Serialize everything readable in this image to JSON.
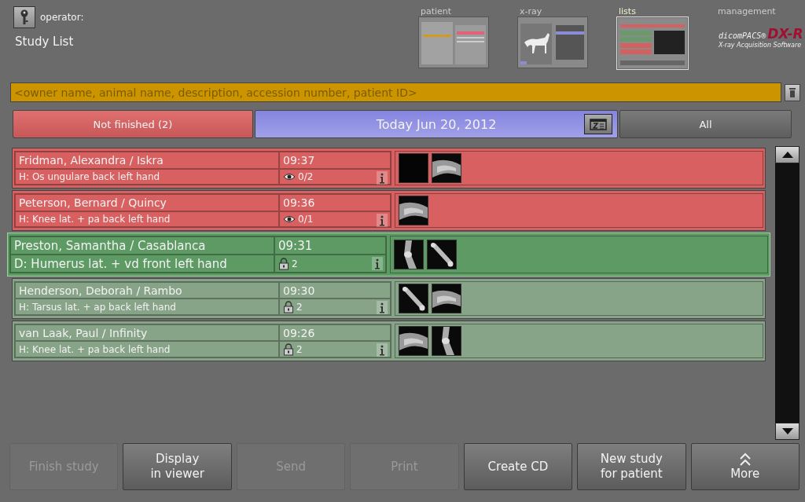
{
  "header": {
    "operator_label": "operator:",
    "title": "Study List"
  },
  "nav": [
    {
      "label": "patient",
      "kind": "patient",
      "selected": false
    },
    {
      "label": "x-ray",
      "kind": "xray",
      "selected": false
    },
    {
      "label": "lists",
      "kind": "lists",
      "selected": true
    },
    {
      "label": "management",
      "kind": "logo",
      "selected": false
    }
  ],
  "logo": {
    "brand": "dicomPACS®",
    "product": "DX-R",
    "tagline": "X-ray Acquisition Software"
  },
  "search": {
    "placeholder": "<owner name, animal name, description, accession number, patient ID>"
  },
  "filters": [
    {
      "label": "Not finished (2)",
      "kind": "unfinished"
    },
    {
      "label": "Today Jun 20, 2012",
      "kind": "date"
    },
    {
      "label": "All",
      "kind": "all"
    }
  ],
  "studies": [
    {
      "name": "Fridman, Alexandra / Iskra",
      "time": "09:37",
      "description": "H: Os ungulare back left hand",
      "kind": "unfinished",
      "count": {
        "kind": "eye",
        "text": "0/2"
      },
      "selected": false,
      "thumbnails": [
        {
          "kind": "blank"
        },
        {
          "kind": "picture"
        }
      ]
    },
    {
      "name": "Peterson, Bernard / Quincy",
      "time": "09:36",
      "description": "H: Knee lat. + pa back left hand",
      "kind": "unfinished",
      "count": {
        "kind": "eye",
        "text": "0/1"
      },
      "selected": false,
      "thumbnails": [
        {
          "kind": "picture"
        }
      ]
    },
    {
      "name": "Preston, Samantha / Casablanca",
      "time": "09:31",
      "description": "D: Humerus lat. + vd front left hand",
      "kind": "finished",
      "count": {
        "kind": "lock",
        "text": "2"
      },
      "selected": true,
      "thumbnails": [
        {
          "kind": "picture"
        },
        {
          "kind": "picture"
        }
      ]
    },
    {
      "name": "Henderson, Deborah / Rambo",
      "time": "09:30",
      "description": "H: Tarsus lat. + ap back left hand",
      "kind": "finished",
      "count": {
        "kind": "lock",
        "text": "2"
      },
      "selected": false,
      "thumbnails": [
        {
          "kind": "picture"
        },
        {
          "kind": "picture"
        }
      ]
    },
    {
      "name": "van Laak, Paul / Infinity",
      "time": "09:26",
      "description": "H: Knee lat. + pa back left hand",
      "kind": "finished",
      "count": {
        "kind": "lock",
        "text": "2"
      },
      "selected": false,
      "thumbnails": [
        {
          "kind": "picture"
        },
        {
          "kind": "picture"
        }
      ]
    }
  ],
  "buttons": [
    {
      "label": "Finish study",
      "disabled": true,
      "kind": "plain"
    },
    {
      "label": "Display\nin viewer",
      "disabled": false,
      "kind": "plain"
    },
    {
      "label": "Send",
      "disabled": true,
      "kind": "plain"
    },
    {
      "label": "Print",
      "disabled": true,
      "kind": "plain"
    },
    {
      "label": "Create CD",
      "disabled": false,
      "kind": "plain"
    },
    {
      "label": "New study\nfor patient",
      "disabled": false,
      "kind": "plain"
    },
    {
      "label": "More",
      "disabled": false,
      "kind": "more"
    }
  ]
}
